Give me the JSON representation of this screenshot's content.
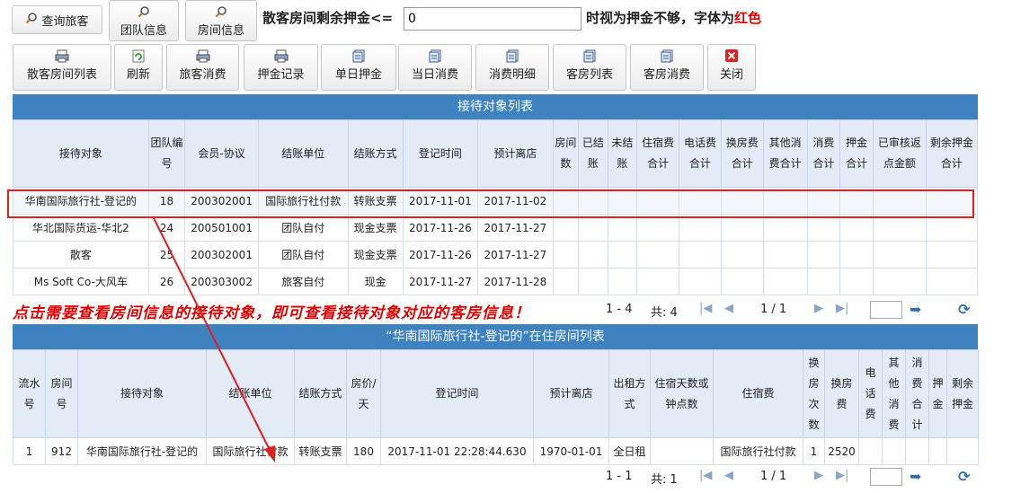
{
  "top_buttons": [
    {
      "label": "查询旅客",
      "icon": "search-icon"
    },
    {
      "label": "团队信息",
      "icon": "search-icon"
    },
    {
      "label": "房间信息",
      "icon": "search-icon"
    }
  ],
  "deposit": {
    "label": "散客房间剩余押金<=",
    "value": "0",
    "suffix_before": "时视为押金不够，字体为",
    "suffix_red": "红色"
  },
  "toolbar": [
    {
      "label": "散客房间列表",
      "icon": "printer-icon"
    },
    {
      "label": "刷新",
      "icon": "refresh-icon"
    },
    {
      "label": "旅客消费",
      "icon": "printer-icon"
    },
    {
      "label": "押金记录",
      "icon": "printer-icon"
    },
    {
      "label": "单日押金",
      "icon": "document-icon"
    },
    {
      "label": "当日消费",
      "icon": "document-icon"
    },
    {
      "label": "消费明细",
      "icon": "document-icon"
    },
    {
      "label": "客房列表",
      "icon": "document-icon"
    },
    {
      "label": "客房消费",
      "icon": "document-icon"
    },
    {
      "label": "关闭",
      "icon": "close-icon"
    }
  ],
  "reception_panel": {
    "title": "接待对象列表",
    "columns": [
      "接待对象",
      "团队编号",
      "会员-协议",
      "结账单位",
      "结账方式",
      "登记时间",
      "预计离店",
      "房间数",
      "已结账",
      "未结账",
      "住宿费合计",
      "电话费合计",
      "换房费合计",
      "其他消费合计",
      "消费合计",
      "押金合计",
      "已审核返点金额",
      "剩余押金合计"
    ],
    "rows": [
      [
        "华南国际旅行社-登记的",
        "18",
        "200302001",
        "国际旅行社付款",
        "转账支票",
        "2017-11-01",
        "2017-11-02",
        "",
        "",
        "",
        "",
        "",
        "",
        "",
        "",
        "",
        "",
        ""
      ],
      [
        "华北国际货运-华北2",
        "24",
        "200501001",
        "团队自付",
        "现金支票",
        "2017-11-26",
        "2017-11-27",
        "",
        "",
        "",
        "",
        "",
        "",
        "",
        "",
        "",
        "",
        ""
      ],
      [
        "散客",
        "25",
        "200302001",
        "团队自付",
        "现金支票",
        "2017-11-26",
        "2017-11-27",
        "",
        "",
        "",
        "",
        "",
        "",
        "",
        "",
        "",
        "",
        ""
      ],
      [
        "Ms Soft Co-大风车",
        "26",
        "200303002",
        "旅客自付",
        "现金",
        "2017-11-27",
        "2017-11-28",
        "",
        "",
        "",
        "",
        "",
        "",
        "",
        "",
        "",
        "",
        ""
      ]
    ],
    "pager": {
      "range": "1 - 4",
      "total": "共: 4",
      "page": "1 / 1"
    }
  },
  "hint": "点击需要查看房间信息的接待对象，即可查看接待对象对应的客房信息！",
  "rooms_panel": {
    "title": "“华南国际旅行社-登记的”在住房间列表",
    "columns": [
      "流水号",
      "房间号",
      "接待对象",
      "结账单位",
      "结账方式",
      "房价/天",
      "登记时间",
      "预计离店",
      "出租方式",
      "住宿天数或钟点数",
      "住宿费",
      "换房次数",
      "换房费",
      "电话费",
      "其他消费",
      "消费合计",
      "押金",
      "剩余押金"
    ],
    "rows": [
      [
        "1",
        "912",
        "华南国际旅行社-登记的",
        "国际旅行社付款",
        "转账支票",
        "180",
        "2017-11-01 22:28:44.630",
        "1970-01-01",
        "全日租",
        "",
        "国际旅行社付款",
        "1",
        "2520",
        "",
        "",
        "",
        "",
        ""
      ]
    ],
    "pager": {
      "range": "1 - 1",
      "total": "共: 1",
      "page": "1 / 1"
    }
  },
  "colors": {
    "panel_header": "#3e82c0",
    "highlight": "#e02020",
    "hint_text": "#e00000"
  }
}
